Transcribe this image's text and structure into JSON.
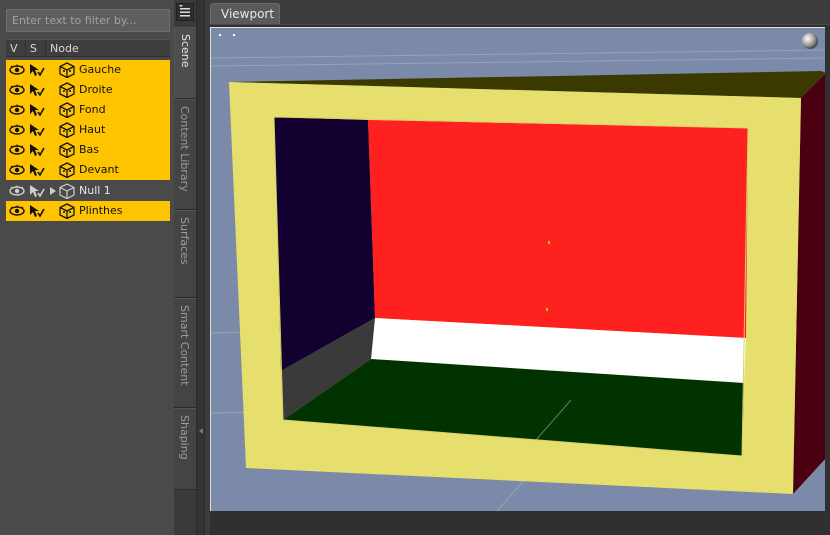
{
  "filter": {
    "placeholder": "Enter text to filter by..."
  },
  "tree": {
    "headers": {
      "v": "V",
      "s": "S",
      "node": "Node"
    },
    "rows": [
      {
        "label": "Gauche",
        "selected": true,
        "icon": "figure-cube-icon"
      },
      {
        "label": "Droite",
        "selected": true,
        "icon": "figure-cube-icon"
      },
      {
        "label": "Fond",
        "selected": true,
        "icon": "figure-cube-icon"
      },
      {
        "label": "Haut",
        "selected": true,
        "icon": "figure-cube-icon"
      },
      {
        "label": "Bas",
        "selected": true,
        "icon": "figure-cube-icon"
      },
      {
        "label": "Devant",
        "selected": true,
        "icon": "figure-cube-icon"
      },
      {
        "label": "Null 1",
        "selected": false,
        "icon": "null-node-icon",
        "expander": true
      },
      {
        "label": "Plinthes",
        "selected": true,
        "icon": "figure-cube-icon"
      }
    ]
  },
  "side_tabs": [
    {
      "label": "Scene",
      "active": true
    },
    {
      "label": "Content Library",
      "active": false
    },
    {
      "label": "Surfaces",
      "active": false
    },
    {
      "label": "Smart Content",
      "active": false
    },
    {
      "label": "Shaping",
      "active": false
    }
  ],
  "viewport": {
    "tab_label": "Viewport"
  },
  "colors": {
    "selection": "#ffc400",
    "viewport_bg": "#7b8aa8",
    "back_wall": "#ff2020",
    "left_wall": "#120030",
    "floor": "#003300",
    "skirting": "#ffffff",
    "frame": "#e6df6e",
    "top": "#3a3a00",
    "right_side": "#4a0010"
  }
}
